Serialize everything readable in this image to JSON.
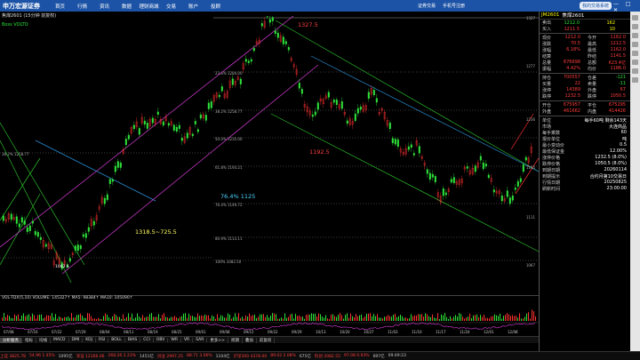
{
  "app": {
    "logo": "申万宏源证券",
    "menu": [
      "首页",
      "行情",
      "资讯",
      "数据",
      "理财商城",
      "交易",
      "账户",
      "投顾"
    ],
    "links": [
      "证券交易",
      "手机号注册"
    ],
    "trade_button": "我的交易系统",
    "window_controls": "— □ ✕"
  },
  "chart": {
    "title": "焦煤2601 (15分钟 前复权)",
    "indicator": "Boss VOLTO",
    "price_labels": [
      {
        "text": "1327.5",
        "color": "#ff4040"
      },
      {
        "text": "1192.5",
        "color": "#ff4040"
      },
      {
        "text": "76.4%  1125",
        "color": "#4bd3ff"
      },
      {
        "text": "1318.5~725.5",
        "color": "#ffff60"
      },
      {
        "text": "1082.5",
        "color": "#ffffff"
      }
    ],
    "fib_labels": [
      "23.6%  1284.00",
      "38.2%  1258.77",
      "50.0%  1235.00",
      "61.8%  1193.21",
      "76.4%  1149.72",
      "80.9%  1113.11",
      "100%  1082.50",
      "76.4%  1125.00"
    ],
    "axis_ticks": [
      "1327",
      "1277",
      "1236",
      "1165",
      "1111",
      "1067"
    ]
  },
  "volume": {
    "header": "VOL-TDX(5,10)  VOLUME: 145327↑  MA5: 98384↑  MA10: 105090↑",
    "side_label": "MACD (12,26,9)  DIF: 13.147  DEA: 6.621  MACD: 13.052"
  },
  "dates": [
    "07/08",
    "07/16",
    "07/22",
    "07/29",
    "08/04",
    "08/11",
    "08/19",
    "08/25",
    "09/01",
    "09/08",
    "09/15",
    "09/22",
    "09/29",
    "10/13",
    "10/20",
    "10/27",
    "11/03",
    "11/10",
    "11/17",
    "11/24",
    "12/01",
    "12/08"
  ],
  "tabs": [
    "分析服务",
    "指标",
    "均线",
    "MACD",
    "DMI",
    "KDJ",
    "RSI",
    "BOLL",
    "BIAS",
    "CCI",
    "OBV",
    "WR",
    "VR",
    "SAR",
    "更多>>",
    "周期",
    "叠加",
    "前复权"
  ],
  "status": [
    {
      "text": "上证 3825.78",
      "color": "#ff3c3c"
    },
    {
      "text": "54.96  1.45%",
      "color": "#ff3c3c"
    },
    {
      "text": "1095亿",
      "color": "#ccc"
    },
    {
      "text": "深证 12166.06",
      "color": "#ff3c3c"
    },
    {
      "text": "268.26  2.23%",
      "color": "#ff3c3c"
    },
    {
      "text": "1451亿",
      "color": "#ccc"
    },
    {
      "text": "创业 2997.25",
      "color": "#ff3c3c"
    },
    {
      "text": "88.71  3.06%",
      "color": "#ff3c3c"
    },
    {
      "text": "1104亿",
      "color": "#ccc"
    },
    {
      "text": "沪深300 4378.00",
      "color": "#ff3c3c"
    },
    {
      "text": "89.02  2.08%",
      "color": "#ff3c3c"
    },
    {
      "text": "675亿",
      "color": "#ccc"
    },
    {
      "text": "科创 2082.55",
      "color": "#ff3c3c"
    },
    {
      "text": "97.08  0.93%",
      "color": "#ff3c3c"
    },
    {
      "text": "697亿",
      "color": "#ccc"
    },
    {
      "text": "09:49:23",
      "color": "#ccc"
    }
  ],
  "quote": {
    "code": "JM2601",
    "name": "焦煤2601",
    "sell": {
      "label": "卖出",
      "price": "1212.0",
      "vol": "162"
    },
    "buy": {
      "label": "买入",
      "price": "1211.5",
      "vol": "10"
    },
    "rows": [
      {
        "l1": "现价",
        "v1": "1212.0",
        "l2": "今开",
        "v2": "1162.0"
      },
      {
        "l1": "涨跌",
        "v1": "70.5",
        "l2": "最高",
        "v2": "1212.5"
      },
      {
        "l1": "涨幅",
        "v1": "6.18%",
        "l2": "最低",
        "v2": "1162.0"
      },
      {
        "l1": "结算",
        "v1": "",
        "l2": "昨结",
        "v2": "1141.5"
      },
      {
        "l1": "总量",
        "v1": "876698",
        "l2": "总额",
        "v2": "623.4亿"
      },
      {
        "l1": "振幅",
        "v1": "4.42%",
        "l2": "均价",
        "v2": "1186.0"
      }
    ],
    "pos": [
      {
        "l1": "持仓",
        "v1": "700557",
        "l2": "仓差",
        "v2": "-121"
      },
      {
        "l1": "买量",
        "v1": "22",
        "l2": "卖量",
        "v2": "-11"
      },
      {
        "l1": "涨停",
        "v1": "14389",
        "l2": "外盘",
        "v2": "67"
      },
      {
        "l1": "跌停",
        "v1": "1232.5",
        "l2": "跌停",
        "v2": "1050.5"
      }
    ],
    "open": [
      {
        "l1": "开仓",
        "v1": "675957",
        "l2": "平仓",
        "v2": "675295"
      },
      {
        "l1": "外盘",
        "v1": "461662",
        "l2": "内盘",
        "v2": "414426"
      }
    ],
    "info": [
      {
        "l": "单位",
        "v": "每手60吨  剩余143天"
      },
      {
        "l": "市场",
        "v": "大连商品"
      },
      {
        "l": "每手乘数",
        "v": "60"
      },
      {
        "l": "报价单位",
        "v": "吨"
      },
      {
        "l": "最小变动价",
        "v": "0.5"
      },
      {
        "l": "最低保证金",
        "v": "12.00%"
      },
      {
        "l": "涨停价格",
        "v": "1232.5 (8.0%)"
      },
      {
        "l": "跌停价格",
        "v": "1050.5 (8.0%)"
      },
      {
        "l": "到期日期",
        "v": "20260114"
      },
      {
        "l": "到期提示",
        "v": "合约月第10交易日"
      },
      {
        "l": "行情日期",
        "v": "20250825"
      },
      {
        "l": "刷新时间",
        "v": "23:00:00"
      }
    ]
  }
}
